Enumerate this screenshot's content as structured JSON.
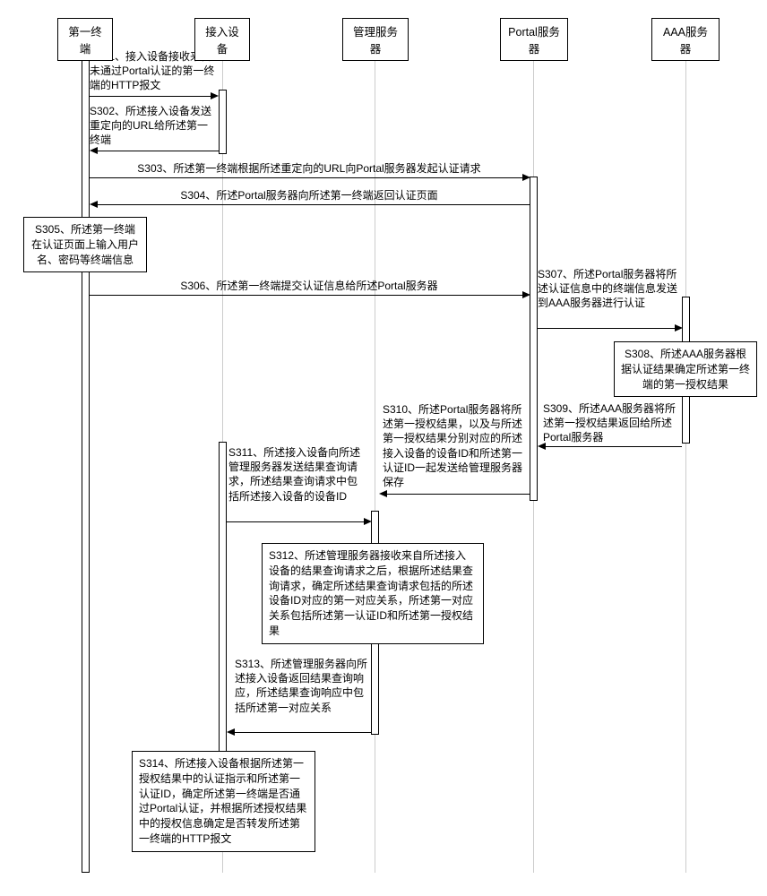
{
  "participants": {
    "p1": "第一终端",
    "p2": "接入设备",
    "p3": "管理服务器",
    "p4": "Portal服务器",
    "p5": "AAA服务器"
  },
  "steps": {
    "s301": "S301、接入设备接收来自未通过Portal认证的第一终端的HTTP报文",
    "s302": "S302、所述接入设备发送重定向的URL给所述第一终端",
    "s303": "S303、所述第一终端根据所述重定向的URL向Portal服务器发起认证请求",
    "s304": "S304、所述Portal服务器向所述第一终端返回认证页面",
    "s305": "S305、所述第一终端在认证页面上输入用户名、密码等终端信息",
    "s306": "S306、所述第一终端提交认证信息给所述Portal服务器",
    "s307": "S307、所述Portal服务器将所述认证信息中的终端信息发送到AAA服务器进行认证",
    "s308": "S308、所述AAA服务器根据认证结果确定所述第一终端的第一授权结果",
    "s309": "S309、所述AAA服务器将所述第一授权结果返回给所述Portal服务器",
    "s310": "S310、所述Portal服务器将所述第一授权结果，以及与所述第一授权结果分别对应的所述接入设备的设备ID和所述第一认证ID一起发送给管理服务器保存",
    "s311": "S311、所述接入设备向所述管理服务器发送结果查询请求，所述结果查询请求中包括所述接入设备的设备ID",
    "s312": "S312、所述管理服务器接收来自所述接入设备的结果查询请求之后，根据所述结果查询请求，确定所述结果查询请求包括的所述设备ID对应的第一对应关系，所述第一对应关系包括所述第一认证ID和所述第一授权结果",
    "s313": "S313、所述管理服务器向所述接入设备返回结果查询响应，所述结果查询响应中包括所述第一对应关系",
    "s314": "S314、所述接入设备根据所述第一授权结果中的认证指示和所述第一认证ID，确定所述第一终端是否通过Portal认证，并根据所述授权结果中的授权信息确定是否转发所述第一终端的HTTP报文"
  }
}
